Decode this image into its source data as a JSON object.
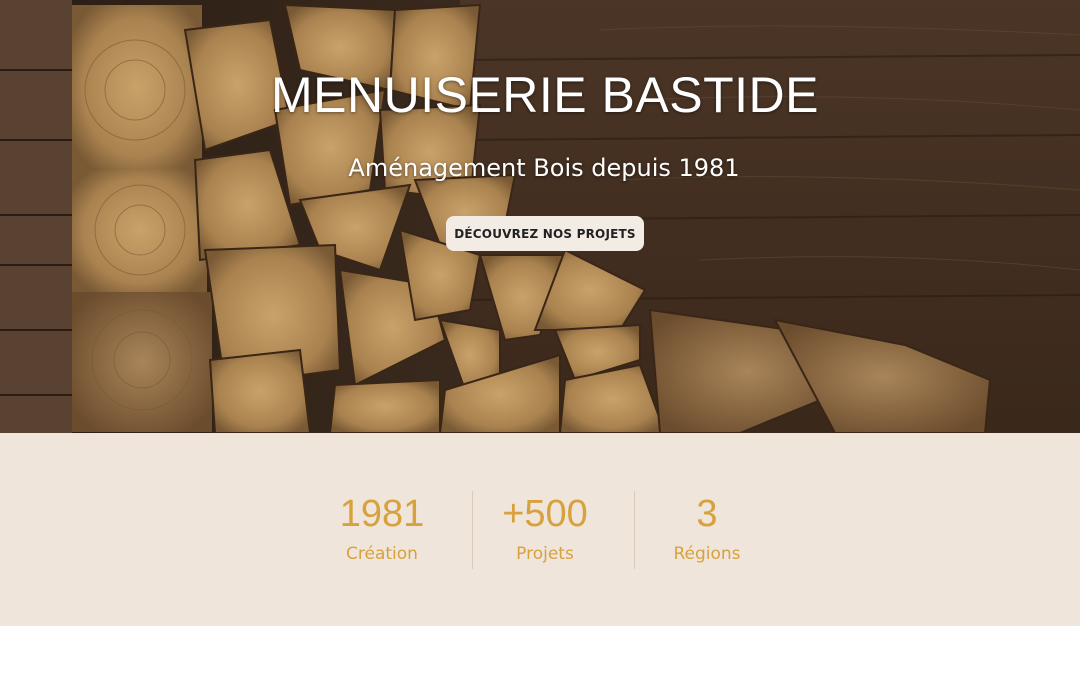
{
  "hero": {
    "title": "MENUISERIE BASTIDE",
    "subtitle": "Aménagement Bois depuis 1981",
    "cta_label": "DÉCOUVREZ NOS PROJETS",
    "background_image": "firewood-stack"
  },
  "stats": [
    {
      "value": "1981",
      "label": "Création"
    },
    {
      "value": "+500",
      "label": "Projets"
    },
    {
      "value": "3",
      "label": "Régions"
    }
  ],
  "colors": {
    "accent": "#d7a23d",
    "stats_background": "#efe5da",
    "button_background": "#f3ece4",
    "wood_dark": "#3a2a1e"
  }
}
